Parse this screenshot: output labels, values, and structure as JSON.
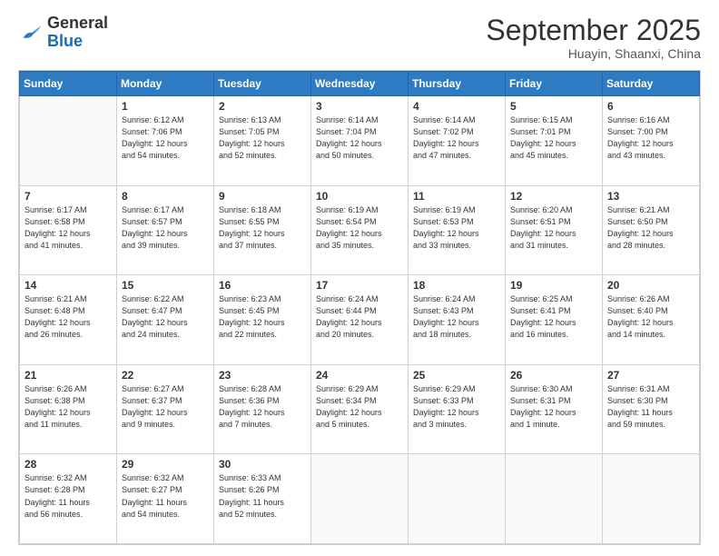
{
  "header": {
    "logo_general": "General",
    "logo_blue": "Blue",
    "month": "September 2025",
    "location": "Huayin, Shaanxi, China"
  },
  "days_of_week": [
    "Sunday",
    "Monday",
    "Tuesday",
    "Wednesday",
    "Thursday",
    "Friday",
    "Saturday"
  ],
  "weeks": [
    [
      {
        "day": "",
        "info": ""
      },
      {
        "day": "1",
        "info": "Sunrise: 6:12 AM\nSunset: 7:06 PM\nDaylight: 12 hours\nand 54 minutes."
      },
      {
        "day": "2",
        "info": "Sunrise: 6:13 AM\nSunset: 7:05 PM\nDaylight: 12 hours\nand 52 minutes."
      },
      {
        "day": "3",
        "info": "Sunrise: 6:14 AM\nSunset: 7:04 PM\nDaylight: 12 hours\nand 50 minutes."
      },
      {
        "day": "4",
        "info": "Sunrise: 6:14 AM\nSunset: 7:02 PM\nDaylight: 12 hours\nand 47 minutes."
      },
      {
        "day": "5",
        "info": "Sunrise: 6:15 AM\nSunset: 7:01 PM\nDaylight: 12 hours\nand 45 minutes."
      },
      {
        "day": "6",
        "info": "Sunrise: 6:16 AM\nSunset: 7:00 PM\nDaylight: 12 hours\nand 43 minutes."
      }
    ],
    [
      {
        "day": "7",
        "info": "Sunrise: 6:17 AM\nSunset: 6:58 PM\nDaylight: 12 hours\nand 41 minutes."
      },
      {
        "day": "8",
        "info": "Sunrise: 6:17 AM\nSunset: 6:57 PM\nDaylight: 12 hours\nand 39 minutes."
      },
      {
        "day": "9",
        "info": "Sunrise: 6:18 AM\nSunset: 6:55 PM\nDaylight: 12 hours\nand 37 minutes."
      },
      {
        "day": "10",
        "info": "Sunrise: 6:19 AM\nSunset: 6:54 PM\nDaylight: 12 hours\nand 35 minutes."
      },
      {
        "day": "11",
        "info": "Sunrise: 6:19 AM\nSunset: 6:53 PM\nDaylight: 12 hours\nand 33 minutes."
      },
      {
        "day": "12",
        "info": "Sunrise: 6:20 AM\nSunset: 6:51 PM\nDaylight: 12 hours\nand 31 minutes."
      },
      {
        "day": "13",
        "info": "Sunrise: 6:21 AM\nSunset: 6:50 PM\nDaylight: 12 hours\nand 28 minutes."
      }
    ],
    [
      {
        "day": "14",
        "info": "Sunrise: 6:21 AM\nSunset: 6:48 PM\nDaylight: 12 hours\nand 26 minutes."
      },
      {
        "day": "15",
        "info": "Sunrise: 6:22 AM\nSunset: 6:47 PM\nDaylight: 12 hours\nand 24 minutes."
      },
      {
        "day": "16",
        "info": "Sunrise: 6:23 AM\nSunset: 6:45 PM\nDaylight: 12 hours\nand 22 minutes."
      },
      {
        "day": "17",
        "info": "Sunrise: 6:24 AM\nSunset: 6:44 PM\nDaylight: 12 hours\nand 20 minutes."
      },
      {
        "day": "18",
        "info": "Sunrise: 6:24 AM\nSunset: 6:43 PM\nDaylight: 12 hours\nand 18 minutes."
      },
      {
        "day": "19",
        "info": "Sunrise: 6:25 AM\nSunset: 6:41 PM\nDaylight: 12 hours\nand 16 minutes."
      },
      {
        "day": "20",
        "info": "Sunrise: 6:26 AM\nSunset: 6:40 PM\nDaylight: 12 hours\nand 14 minutes."
      }
    ],
    [
      {
        "day": "21",
        "info": "Sunrise: 6:26 AM\nSunset: 6:38 PM\nDaylight: 12 hours\nand 11 minutes."
      },
      {
        "day": "22",
        "info": "Sunrise: 6:27 AM\nSunset: 6:37 PM\nDaylight: 12 hours\nand 9 minutes."
      },
      {
        "day": "23",
        "info": "Sunrise: 6:28 AM\nSunset: 6:36 PM\nDaylight: 12 hours\nand 7 minutes."
      },
      {
        "day": "24",
        "info": "Sunrise: 6:29 AM\nSunset: 6:34 PM\nDaylight: 12 hours\nand 5 minutes."
      },
      {
        "day": "25",
        "info": "Sunrise: 6:29 AM\nSunset: 6:33 PM\nDaylight: 12 hours\nand 3 minutes."
      },
      {
        "day": "26",
        "info": "Sunrise: 6:30 AM\nSunset: 6:31 PM\nDaylight: 12 hours\nand 1 minute."
      },
      {
        "day": "27",
        "info": "Sunrise: 6:31 AM\nSunset: 6:30 PM\nDaylight: 11 hours\nand 59 minutes."
      }
    ],
    [
      {
        "day": "28",
        "info": "Sunrise: 6:32 AM\nSunset: 6:28 PM\nDaylight: 11 hours\nand 56 minutes."
      },
      {
        "day": "29",
        "info": "Sunrise: 6:32 AM\nSunset: 6:27 PM\nDaylight: 11 hours\nand 54 minutes."
      },
      {
        "day": "30",
        "info": "Sunrise: 6:33 AM\nSunset: 6:26 PM\nDaylight: 11 hours\nand 52 minutes."
      },
      {
        "day": "",
        "info": ""
      },
      {
        "day": "",
        "info": ""
      },
      {
        "day": "",
        "info": ""
      },
      {
        "day": "",
        "info": ""
      }
    ]
  ]
}
